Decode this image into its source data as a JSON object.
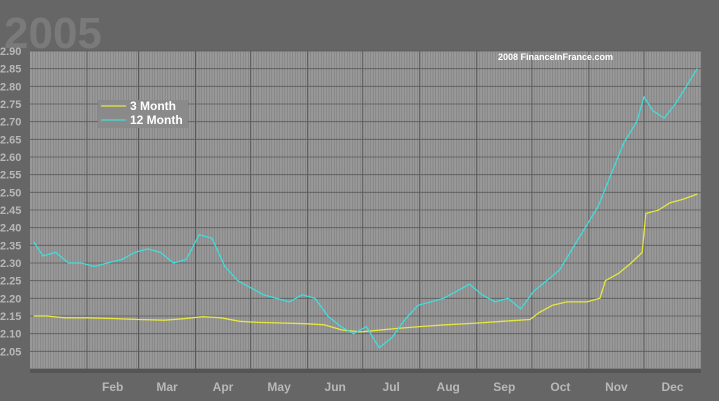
{
  "chart_data": {
    "type": "line",
    "title": "2005",
    "watermark": "2008 FinanceInFrance.com",
    "xlabel": "",
    "ylabel": "",
    "ylim": [
      2.0,
      2.9
    ],
    "y_ticks": [
      "2.90",
      "2.85",
      "2.80",
      "2.75",
      "2.70",
      "2.65",
      "2.60",
      "2.55",
      "2.50",
      "2.45",
      "2.40",
      "2.35",
      "2.30",
      "2.25",
      "2.20",
      "2.15",
      "2.10",
      "2.05"
    ],
    "x_month_labels": [
      "Feb",
      "Mar",
      "Apr",
      "May",
      "Jun",
      "Jul",
      "Aug",
      "Sep",
      "Oct",
      "Nov",
      "Dec"
    ],
    "grid": "on",
    "legend_position": "top-left",
    "colors": {
      "background": "#666666",
      "plot": "#999999",
      "grid_minor": "#7c7c7c",
      "grid_major": "#5a5a5a",
      "text": "#b8b8b8",
      "title": "#7a7a7a",
      "legend_bg": "#8a8a8a"
    },
    "series": [
      {
        "name": "3 Month",
        "color": "#e6e640",
        "points": [
          [
            "2005-01-03",
            2.15
          ],
          [
            "2005-01-10",
            2.15
          ],
          [
            "2005-01-20",
            2.145
          ],
          [
            "2005-02-01",
            2.145
          ],
          [
            "2005-02-15",
            2.143
          ],
          [
            "2005-03-01",
            2.14
          ],
          [
            "2005-03-15",
            2.138
          ],
          [
            "2005-03-25",
            2.142
          ],
          [
            "2005-04-05",
            2.148
          ],
          [
            "2005-04-15",
            2.145
          ],
          [
            "2005-04-25",
            2.135
          ],
          [
            "2005-05-05",
            2.132
          ],
          [
            "2005-05-20",
            2.13
          ],
          [
            "2005-06-01",
            2.128
          ],
          [
            "2005-06-10",
            2.125
          ],
          [
            "2005-06-20",
            2.11
          ],
          [
            "2005-06-30",
            2.105
          ],
          [
            "2005-07-10",
            2.11
          ],
          [
            "2005-07-20",
            2.115
          ],
          [
            "2005-08-01",
            2.12
          ],
          [
            "2005-08-15",
            2.125
          ],
          [
            "2005-09-01",
            2.13
          ],
          [
            "2005-09-15",
            2.135
          ],
          [
            "2005-09-30",
            2.14
          ],
          [
            "2005-10-05",
            2.16
          ],
          [
            "2005-10-12",
            2.18
          ],
          [
            "2005-10-20",
            2.19
          ],
          [
            "2005-10-31",
            2.19
          ],
          [
            "2005-11-07",
            2.2
          ],
          [
            "2005-11-10",
            2.25
          ],
          [
            "2005-11-17",
            2.27
          ],
          [
            "2005-11-24",
            2.3
          ],
          [
            "2005-11-30",
            2.33
          ],
          [
            "2005-12-02",
            2.44
          ],
          [
            "2005-12-09",
            2.45
          ],
          [
            "2005-12-15",
            2.47
          ],
          [
            "2005-12-22",
            2.48
          ],
          [
            "2005-12-30",
            2.495
          ]
        ]
      },
      {
        "name": "12 Month",
        "color": "#40dcdc",
        "points": [
          [
            "2005-01-03",
            2.36
          ],
          [
            "2005-01-08",
            2.32
          ],
          [
            "2005-01-15",
            2.33
          ],
          [
            "2005-01-22",
            2.3
          ],
          [
            "2005-01-29",
            2.3
          ],
          [
            "2005-02-05",
            2.29
          ],
          [
            "2005-02-12",
            2.3
          ],
          [
            "2005-02-20",
            2.31
          ],
          [
            "2005-02-27",
            2.33
          ],
          [
            "2005-03-06",
            2.34
          ],
          [
            "2005-03-13",
            2.33
          ],
          [
            "2005-03-20",
            2.3
          ],
          [
            "2005-03-27",
            2.31
          ],
          [
            "2005-04-03",
            2.38
          ],
          [
            "2005-04-10",
            2.37
          ],
          [
            "2005-04-17",
            2.29
          ],
          [
            "2005-04-24",
            2.25
          ],
          [
            "2005-05-01",
            2.23
          ],
          [
            "2005-05-08",
            2.21
          ],
          [
            "2005-05-15",
            2.2
          ],
          [
            "2005-05-22",
            2.19
          ],
          [
            "2005-05-29",
            2.21
          ],
          [
            "2005-06-05",
            2.2
          ],
          [
            "2005-06-12",
            2.15
          ],
          [
            "2005-06-19",
            2.12
          ],
          [
            "2005-06-26",
            2.1
          ],
          [
            "2005-07-03",
            2.12
          ],
          [
            "2005-07-10",
            2.06
          ],
          [
            "2005-07-17",
            2.09
          ],
          [
            "2005-07-24",
            2.14
          ],
          [
            "2005-07-31",
            2.18
          ],
          [
            "2005-08-07",
            2.19
          ],
          [
            "2005-08-14",
            2.2
          ],
          [
            "2005-08-21",
            2.22
          ],
          [
            "2005-08-28",
            2.24
          ],
          [
            "2005-09-04",
            2.21
          ],
          [
            "2005-09-11",
            2.19
          ],
          [
            "2005-09-18",
            2.2
          ],
          [
            "2005-09-25",
            2.17
          ],
          [
            "2005-10-02",
            2.22
          ],
          [
            "2005-10-09",
            2.25
          ],
          [
            "2005-10-16",
            2.28
          ],
          [
            "2005-10-23",
            2.34
          ],
          [
            "2005-10-30",
            2.4
          ],
          [
            "2005-11-06",
            2.46
          ],
          [
            "2005-11-13",
            2.55
          ],
          [
            "2005-11-20",
            2.64
          ],
          [
            "2005-11-27",
            2.7
          ],
          [
            "2005-12-01",
            2.77
          ],
          [
            "2005-12-06",
            2.73
          ],
          [
            "2005-12-12",
            2.71
          ],
          [
            "2005-12-18",
            2.75
          ],
          [
            "2005-12-24",
            2.8
          ],
          [
            "2005-12-30",
            2.85
          ]
        ]
      }
    ]
  }
}
